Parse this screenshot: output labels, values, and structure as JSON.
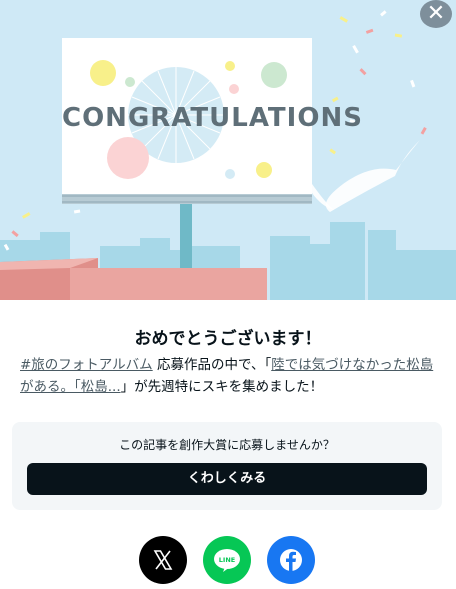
{
  "close": {
    "glyph": "✕"
  },
  "hero": {
    "board_text": "CONGRATULATIONS",
    "colors": {
      "sky": "#cfe9f6",
      "board": "#ffffff",
      "ground": "#e8a29c"
    }
  },
  "dialog": {
    "title": "おめでとうございます！",
    "hashtag": "#旅のフォトアルバム",
    "text1": " 応募作品の中で、「",
    "article": "陸では気づけなかった松島がある。「松島...",
    "text2": "」が先週特にスキを集めました！"
  },
  "promo": {
    "question": "この記事を創作大賞に応募しませんか？",
    "button": "くわしくみる"
  },
  "share": {
    "x": {
      "icon": "x-logo-icon",
      "color": "#000000",
      "label": "𝕏"
    },
    "line": {
      "icon": "line-logo-icon",
      "color": "#06c755",
      "label": "LINE"
    },
    "facebook": {
      "icon": "facebook-logo-icon",
      "color": "#1877f2",
      "label": "f"
    }
  }
}
